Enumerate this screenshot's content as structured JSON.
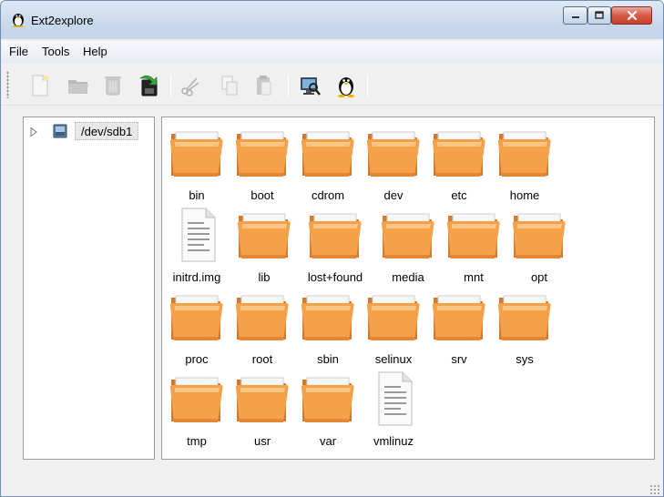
{
  "window": {
    "title": "Ext2explore",
    "app_icon": "penguin-icon"
  },
  "caption_buttons": [
    {
      "name": "minimize-button",
      "icon": "minimize-icon"
    },
    {
      "name": "maximize-button",
      "icon": "maximize-icon"
    },
    {
      "name": "close-button",
      "icon": "close-icon"
    }
  ],
  "menubar": {
    "items": [
      "File",
      "Tools",
      "Help"
    ]
  },
  "toolbar": {
    "buttons": [
      {
        "icon": "new-file-icon",
        "enabled": false
      },
      {
        "icon": "open-folder-icon",
        "enabled": false
      },
      {
        "icon": "delete-icon",
        "enabled": false
      },
      {
        "icon": "save-export-icon",
        "enabled": true
      },
      {
        "icon": "cut-icon",
        "enabled": false
      },
      {
        "icon": "copy-icon",
        "enabled": false
      },
      {
        "icon": "paste-icon",
        "enabled": false
      },
      {
        "icon": "computer-scan-icon",
        "enabled": true
      },
      {
        "icon": "linux-penguin-icon",
        "enabled": true
      }
    ]
  },
  "tree": {
    "root_label": "/dev/sdb1",
    "expanded": false
  },
  "files": [
    {
      "name": "bin",
      "type": "folder"
    },
    {
      "name": "boot",
      "type": "folder"
    },
    {
      "name": "cdrom",
      "type": "folder"
    },
    {
      "name": "dev",
      "type": "folder"
    },
    {
      "name": "etc",
      "type": "folder"
    },
    {
      "name": "home",
      "type": "folder"
    },
    {
      "name": "initrd.img",
      "type": "file"
    },
    {
      "name": "lib",
      "type": "folder"
    },
    {
      "name": "lost+found",
      "type": "folder"
    },
    {
      "name": "media",
      "type": "folder"
    },
    {
      "name": "mnt",
      "type": "folder"
    },
    {
      "name": "opt",
      "type": "folder"
    },
    {
      "name": "proc",
      "type": "folder"
    },
    {
      "name": "root",
      "type": "folder"
    },
    {
      "name": "sbin",
      "type": "folder"
    },
    {
      "name": "selinux",
      "type": "folder"
    },
    {
      "name": "srv",
      "type": "folder"
    },
    {
      "name": "sys",
      "type": "folder"
    },
    {
      "name": "tmp",
      "type": "folder"
    },
    {
      "name": "usr",
      "type": "folder"
    },
    {
      "name": "var",
      "type": "folder"
    },
    {
      "name": "vmlinuz",
      "type": "file"
    }
  ],
  "colors": {
    "folder_main": "#f4a14a",
    "folder_dark": "#d9782a",
    "folder_light": "#fcd39a",
    "titlebar": "#c9d9ec",
    "close_button": "#d55b45"
  }
}
